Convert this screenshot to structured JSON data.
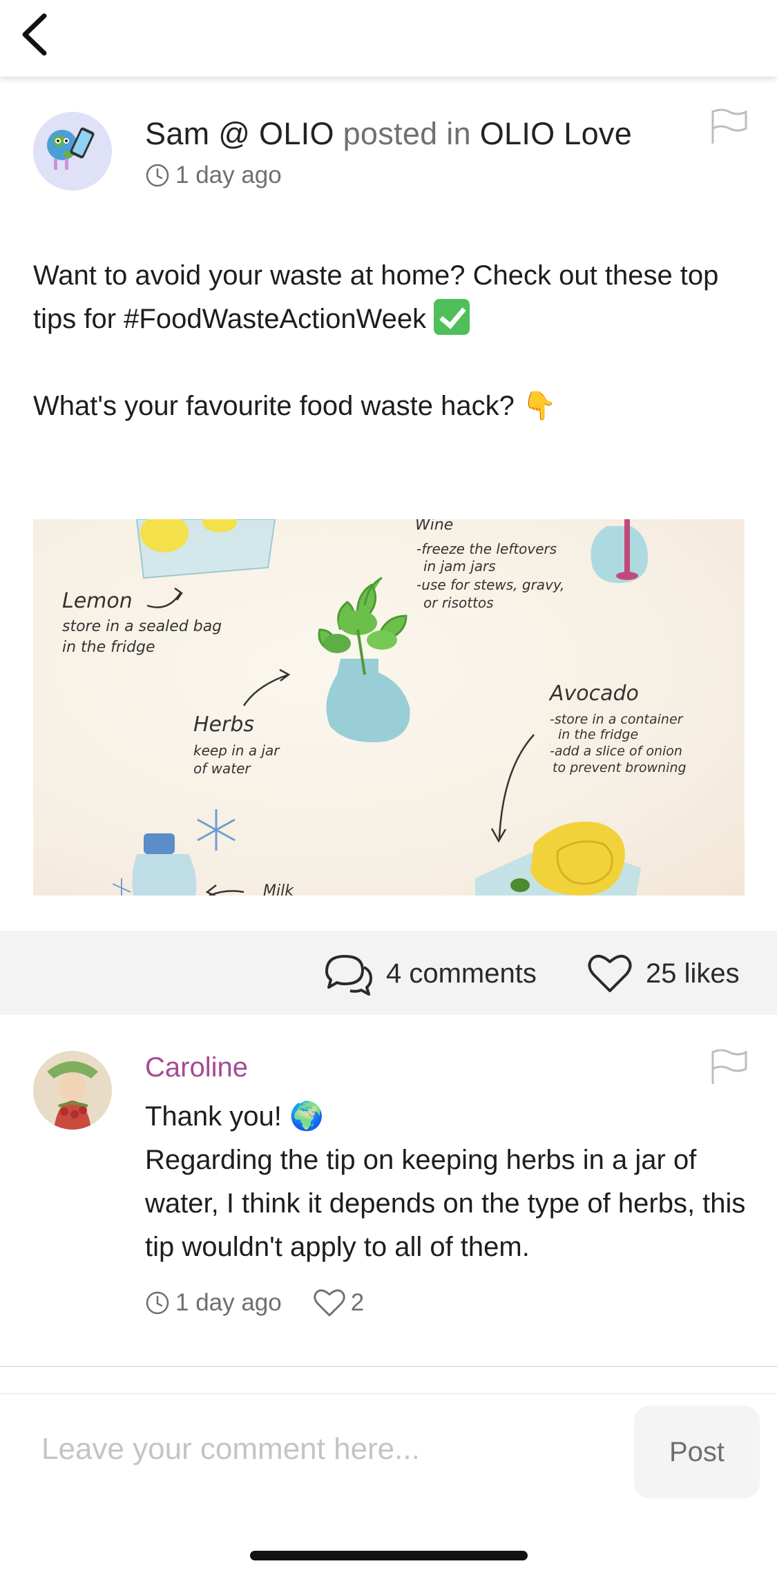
{
  "post": {
    "author": "Sam @ OLIO",
    "posted_in_text": "posted in",
    "group": "OLIO Love",
    "time": "1 day ago",
    "body_line1": "Want to avoid your waste at home? Check out these top tips for #FoodWasteActionWeek",
    "body_line2": "What's your favourite food waste hack?",
    "pointing_emoji": "👇"
  },
  "illustration": {
    "lemon_title": "Lemon",
    "lemon_tip1": "store in a sealed bag",
    "lemon_tip2": "in the fridge",
    "wine_title": "Wine",
    "wine_tip1": "-freeze the leftovers",
    "wine_tip2": "in jam jars",
    "wine_tip3": "-use for stews, gravy,",
    "wine_tip4": "or risottos",
    "herbs_title": "Herbs",
    "herbs_tip1": "keep in a jar",
    "herbs_tip2": "of water",
    "avocado_title": "Avocado",
    "avocado_tip1": "-store in a container",
    "avocado_tip2": "in the fridge",
    "avocado_tip3": "-add a slice of onion",
    "avocado_tip4": "to prevent browning",
    "milk_title": "Milk"
  },
  "stats": {
    "comments_label": "4 comments",
    "likes_label": "25 likes"
  },
  "comment": {
    "author": "Caroline",
    "line1": "Thank you!",
    "globe_emoji": "🌍",
    "body": "Regarding the tip on keeping herbs in a jar of water, I think it depends on the type of herbs, this tip wouldn't apply to all of them.",
    "time": "1 day ago",
    "likes": "2"
  },
  "composer": {
    "placeholder": "Leave your comment here...",
    "post_label": "Post"
  },
  "icons": {
    "back": "chevron-left-icon",
    "flag": "flag-icon",
    "clock": "clock-icon",
    "comments": "chat-bubbles-icon",
    "heart": "heart-icon"
  },
  "colors": {
    "commenter_name": "#a44a93",
    "stats_bar_bg": "#f3f3f3"
  }
}
